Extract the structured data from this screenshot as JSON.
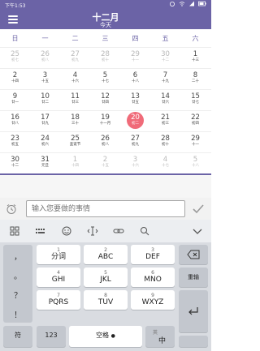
{
  "status": {
    "time": "下午1:53"
  },
  "header": {
    "title": "十二月",
    "subtitle": "今天"
  },
  "calendar": {
    "weekdays": [
      "日",
      "一",
      "二",
      "三",
      "四",
      "五",
      "六"
    ],
    "rows": [
      [
        {
          "d": "25",
          "l": "初七",
          "o": true
        },
        {
          "d": "26",
          "l": "初八",
          "o": true
        },
        {
          "d": "27",
          "l": "初九",
          "o": true
        },
        {
          "d": "28",
          "l": "初十",
          "o": true
        },
        {
          "d": "29",
          "l": "十一",
          "o": true
        },
        {
          "d": "30",
          "l": "十二",
          "o": true
        },
        {
          "d": "1",
          "l": "十三",
          "o": false
        }
      ],
      [
        {
          "d": "2",
          "l": "十四",
          "o": false
        },
        {
          "d": "3",
          "l": "十五",
          "o": false
        },
        {
          "d": "4",
          "l": "十六",
          "o": false
        },
        {
          "d": "5",
          "l": "十七",
          "o": false
        },
        {
          "d": "6",
          "l": "十八",
          "o": false
        },
        {
          "d": "7",
          "l": "十九",
          "o": false
        },
        {
          "d": "8",
          "l": "二十",
          "o": false
        }
      ],
      [
        {
          "d": "9",
          "l": "廿一",
          "o": false
        },
        {
          "d": "10",
          "l": "廿二",
          "o": false
        },
        {
          "d": "11",
          "l": "廿三",
          "o": false
        },
        {
          "d": "12",
          "l": "廿四",
          "o": false
        },
        {
          "d": "13",
          "l": "廿五",
          "o": false
        },
        {
          "d": "14",
          "l": "廿六",
          "o": false
        },
        {
          "d": "15",
          "l": "廿七",
          "o": false
        }
      ],
      [
        {
          "d": "16",
          "l": "廿八",
          "o": false
        },
        {
          "d": "17",
          "l": "廿九",
          "o": false
        },
        {
          "d": "18",
          "l": "三十",
          "o": false
        },
        {
          "d": "19",
          "l": "十一月",
          "o": false
        },
        {
          "d": "20",
          "l": "初二",
          "o": false,
          "today": true
        },
        {
          "d": "21",
          "l": "初三",
          "o": false
        },
        {
          "d": "22",
          "l": "初四",
          "o": false
        }
      ],
      [
        {
          "d": "23",
          "l": "初五",
          "o": false
        },
        {
          "d": "24",
          "l": "初六",
          "o": false
        },
        {
          "d": "25",
          "l": "圣诞节",
          "o": false
        },
        {
          "d": "26",
          "l": "初八",
          "o": false
        },
        {
          "d": "27",
          "l": "初九",
          "o": false
        },
        {
          "d": "28",
          "l": "初十",
          "o": false
        },
        {
          "d": "29",
          "l": "十一",
          "o": false
        }
      ],
      [
        {
          "d": "30",
          "l": "十二",
          "o": false
        },
        {
          "d": "31",
          "l": "元旦",
          "o": false
        },
        {
          "d": "1",
          "l": "十四",
          "o": true
        },
        {
          "d": "2",
          "l": "十五",
          "o": true
        },
        {
          "d": "3",
          "l": "十六",
          "o": true
        },
        {
          "d": "4",
          "l": "十七",
          "o": true
        },
        {
          "d": "5",
          "l": "十八",
          "o": true
        }
      ]
    ]
  },
  "todo": {
    "placeholder": "输入您要做的事情"
  },
  "keyboard": {
    "punct": [
      "，",
      "。",
      "？",
      "！"
    ],
    "keys_row1": [
      {
        "n": "1",
        "t": "分词"
      },
      {
        "n": "2",
        "t": "ABC"
      },
      {
        "n": "3",
        "t": "DEF"
      }
    ],
    "keys_row2": [
      {
        "n": "4",
        "t": "GHI"
      },
      {
        "n": "5",
        "t": "JKL"
      },
      {
        "n": "6",
        "t": "MNO"
      }
    ],
    "keys_row3": [
      {
        "n": "7",
        "t": "PQRS"
      },
      {
        "n": "8",
        "t": "TUV"
      },
      {
        "n": "9",
        "t": "WXYZ"
      }
    ],
    "reenter": "重输",
    "bottom": {
      "symbol": "符",
      "num": "123",
      "space": "空格",
      "lang_top": "英",
      "lang_bottom": "中"
    }
  },
  "colors": {
    "primary": "#6b63a6",
    "today": "#f06b79"
  }
}
